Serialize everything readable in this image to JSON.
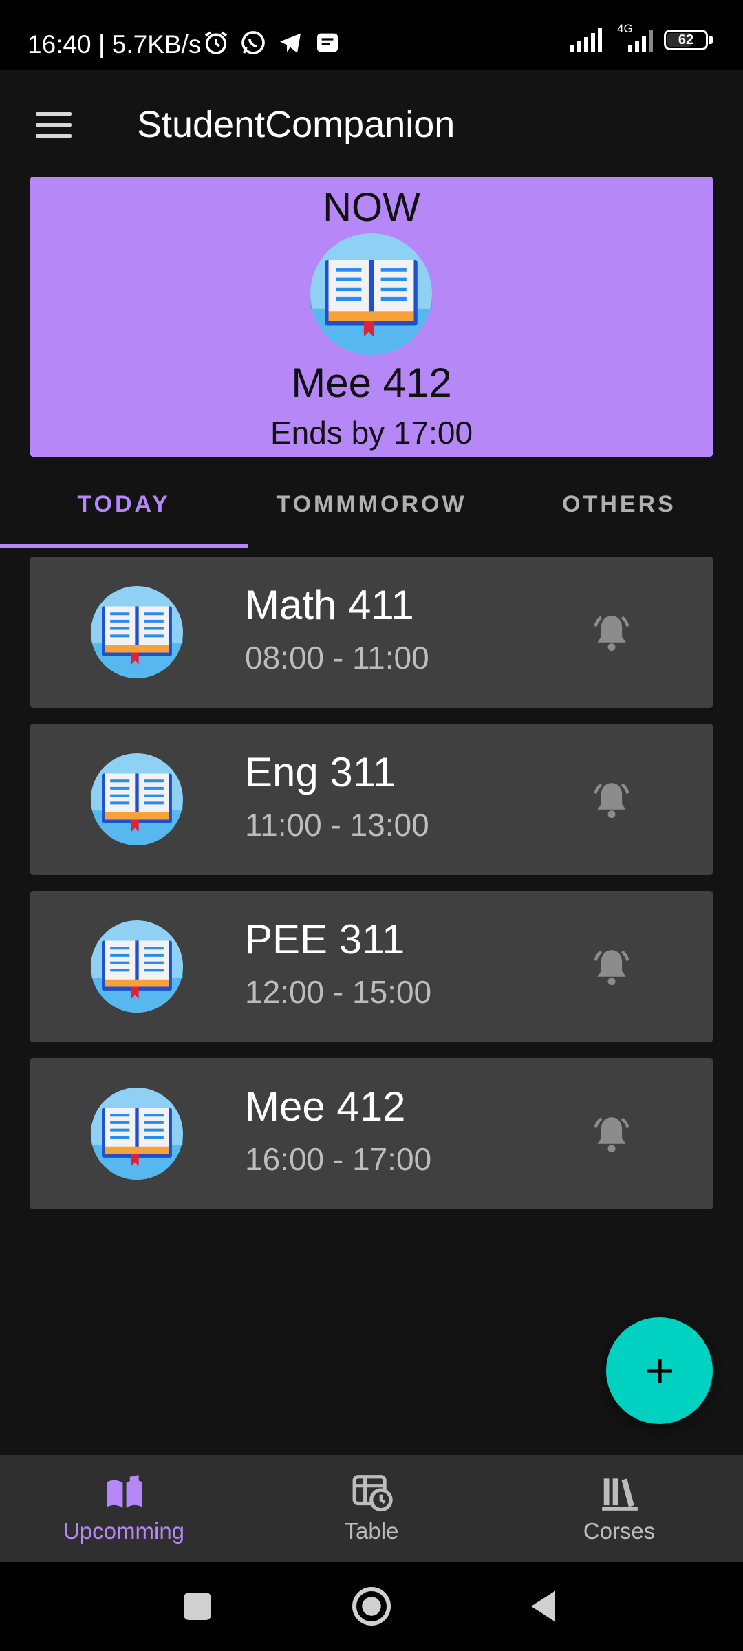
{
  "status_bar": {
    "time": "16:40 | 5.7KB/s",
    "network": "4G",
    "battery": "62",
    "battery_level": 0.62,
    "icons": [
      "alarm-icon",
      "whatsapp-icon",
      "telegram-icon",
      "message-icon",
      "signal-icon",
      "signal-4g-icon",
      "battery-icon"
    ]
  },
  "app_bar": {
    "title": "StudentCompanion",
    "menu_icon": "hamburger-menu-icon"
  },
  "now_card": {
    "label": "NOW",
    "course": "Mee 412",
    "ends": "Ends by 17:00",
    "icon": "open-book-icon",
    "color": "#b687f7"
  },
  "tabs": [
    {
      "label": "TODAY",
      "active": true
    },
    {
      "label": "TOMMMOROW",
      "active": false
    },
    {
      "label": "OTHERS",
      "active": false
    }
  ],
  "classes": [
    {
      "title": "Math 411",
      "time": "08:00 - 11:00"
    },
    {
      "title": "Eng 311",
      "time": "11:00 - 13:00"
    },
    {
      "title": "PEE 311",
      "time": "12:00 - 15:00"
    },
    {
      "title": "Mee 412",
      "time": "16:00 - 17:00"
    }
  ],
  "fab": {
    "icon": "plus-icon",
    "color": "#00d1c1"
  },
  "bottom_nav": [
    {
      "label": "Upcomming",
      "icon": "open-book-icon",
      "active": true
    },
    {
      "label": "Table",
      "icon": "table-clock-icon",
      "active": false
    },
    {
      "label": "Corses",
      "icon": "books-icon",
      "active": false
    }
  ],
  "accent_color": "#b687f7"
}
